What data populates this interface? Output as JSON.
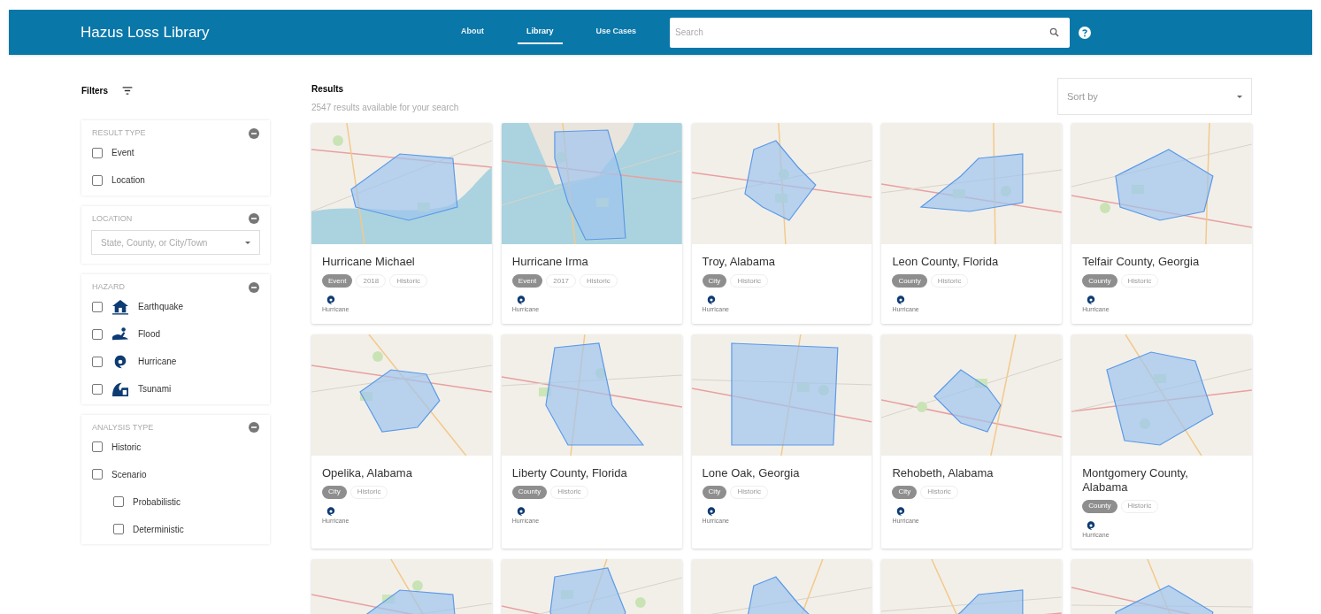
{
  "header": {
    "title": "Hazus Loss Library",
    "nav": [
      {
        "label": "About",
        "selected": false
      },
      {
        "label": "Library",
        "selected": true
      },
      {
        "label": "Use Cases",
        "selected": false
      }
    ],
    "search": {
      "placeholder": "Search"
    }
  },
  "filters": {
    "title": "Filters",
    "sections": [
      {
        "kind": "checkboxes",
        "title": "RESULT TYPE",
        "options": [
          {
            "label": "Event",
            "checked": false
          },
          {
            "label": "Location",
            "checked": false
          }
        ]
      },
      {
        "kind": "select",
        "title": "LOCATION",
        "placeholder": "State, County, or City/Town"
      },
      {
        "kind": "checkboxes",
        "title": "HAZARD",
        "options": [
          {
            "label": "Earthquake",
            "checked": false,
            "kind": "earthquake"
          },
          {
            "label": "Flood",
            "checked": false,
            "kind": "flood"
          },
          {
            "label": "Hurricane",
            "checked": false,
            "kind": "hurricane"
          },
          {
            "label": "Tsunami",
            "checked": false,
            "kind": "tsunami"
          }
        ]
      },
      {
        "kind": "checkboxes",
        "title": "ANALYSIS TYPE",
        "options": [
          {
            "label": "Historic",
            "checked": false
          },
          {
            "label": "Scenario",
            "checked": false,
            "children": [
              {
                "label": "Probabilistic",
                "checked": false
              },
              {
                "label": "Deterministic",
                "checked": false
              }
            ]
          }
        ]
      }
    ]
  },
  "results": {
    "title": "Results",
    "subtitle": "2547 results available for your search",
    "sort": {
      "placeholder": "Sort by"
    },
    "cards": [
      {
        "kind": "result",
        "title": "Hurricane Michael",
        "tags": [
          {
            "label": "Event",
            "kind": "filled"
          },
          {
            "label": "2018",
            "kind": "outlined"
          },
          {
            "label": "Historic",
            "kind": "outlined"
          }
        ],
        "hazard": {
          "kind": "hurricane",
          "label": "Hurricane"
        }
      },
      {
        "kind": "result",
        "title": "Hurricane Irma",
        "tags": [
          {
            "label": "Event",
            "kind": "filled"
          },
          {
            "label": "2017",
            "kind": "outlined"
          },
          {
            "label": "Historic",
            "kind": "outlined"
          }
        ],
        "hazard": {
          "kind": "hurricane",
          "label": "Hurricane"
        }
      },
      {
        "kind": "result",
        "title": "Troy, Alabama",
        "tags": [
          {
            "label": "City",
            "kind": "filled"
          },
          {
            "label": "Historic",
            "kind": "outlined"
          }
        ],
        "hazard": {
          "kind": "hurricane",
          "label": "Hurricane"
        }
      },
      {
        "kind": "result",
        "title": "Leon County, Florida",
        "tags": [
          {
            "label": "County",
            "kind": "filled"
          },
          {
            "label": "Historic",
            "kind": "outlined"
          }
        ],
        "hazard": {
          "kind": "hurricane",
          "label": "Hurricane"
        }
      },
      {
        "kind": "result",
        "title": "Telfair County, Georgia",
        "tags": [
          {
            "label": "County",
            "kind": "filled"
          },
          {
            "label": "Historic",
            "kind": "outlined"
          }
        ],
        "hazard": {
          "kind": "hurricane",
          "label": "Hurricane"
        }
      },
      {
        "kind": "result",
        "title": "Opelika, Alabama",
        "tags": [
          {
            "label": "City",
            "kind": "filled"
          },
          {
            "label": "Historic",
            "kind": "outlined"
          }
        ],
        "hazard": {
          "kind": "hurricane",
          "label": "Hurricane"
        }
      },
      {
        "kind": "result",
        "title": "Liberty County, Florida",
        "tags": [
          {
            "label": "County",
            "kind": "filled"
          },
          {
            "label": "Historic",
            "kind": "outlined"
          }
        ],
        "hazard": {
          "kind": "hurricane",
          "label": "Hurricane"
        }
      },
      {
        "kind": "result",
        "title": "Lone Oak, Georgia",
        "tags": [
          {
            "label": "City",
            "kind": "filled"
          },
          {
            "label": "Historic",
            "kind": "outlined"
          }
        ],
        "hazard": {
          "kind": "hurricane",
          "label": "Hurricane"
        }
      },
      {
        "kind": "result",
        "title": "Rehobeth, Alabama",
        "tags": [
          {
            "label": "City",
            "kind": "filled"
          },
          {
            "label": "Historic",
            "kind": "outlined"
          }
        ],
        "hazard": {
          "kind": "hurricane",
          "label": "Hurricane"
        }
      },
      {
        "kind": "result",
        "title": "Montgomery County, Alabama",
        "tags": [
          {
            "label": "County",
            "kind": "filled"
          },
          {
            "label": "Historic",
            "kind": "outlined"
          }
        ],
        "hazard": {
          "kind": "hurricane",
          "label": "Hurricane"
        }
      },
      {
        "kind": "picture"
      },
      {
        "kind": "picture"
      },
      {
        "kind": "picture"
      },
      {
        "kind": "picture"
      },
      {
        "kind": "picture"
      }
    ]
  }
}
